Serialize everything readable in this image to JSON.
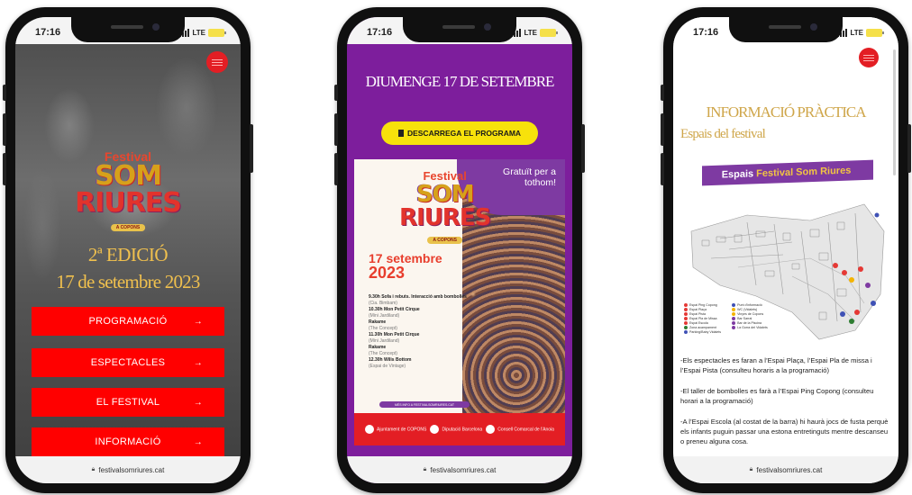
{
  "phones": [
    {
      "status_time": "17:16",
      "carrier": "LTE",
      "url": "festivalsomriures.cat",
      "logo": {
        "line1": "Festival",
        "line2": "SOM",
        "line3": "RIURES",
        "tag": "A COPONS"
      },
      "edition": "2ª EDICIÓ",
      "date": "17 de setembre 2023",
      "menu": [
        {
          "label": "PROGRAMACIÓ",
          "arrow": "→"
        },
        {
          "label": "ESPECTACLES",
          "arrow": "→"
        },
        {
          "label": "EL FESTIVAL",
          "arrow": "→"
        },
        {
          "label": "INFORMACIÓ",
          "arrow": "→"
        }
      ]
    },
    {
      "status_time": "17:16",
      "carrier": "LTE",
      "url": "festivalsomriures.cat",
      "heading": "DIUMENGE 17 DE SETEMBRE",
      "download_label": "DESCARREGA EL PROGRAMA",
      "poster": {
        "logo": {
          "line1": "Festival",
          "line2": "SOM",
          "line3": "RIURES",
          "tag": "A COPONS"
        },
        "ribbon": "Gratuït per a tothom!",
        "date_line1": "17 setembre",
        "date_line2": "2023",
        "schedule": [
          {
            "time": "9.30h",
            "title": "Sofa i rebuts. Interacció amb bombolles",
            "sub": "(Cia. Bimbam)"
          },
          {
            "time": "10.30h",
            "title": "Mon Petit Cirque",
            "sub": "(Mini Jardiland)"
          },
          {
            "time": "",
            "title": "Rakame",
            "sub": "(The Concept)"
          },
          {
            "time": "11.30h",
            "title": "Mon Petit Cirque",
            "sub": "(Mini Jardiland)"
          },
          {
            "time": "",
            "title": "Rakame",
            "sub": "(The Concept)"
          },
          {
            "time": "12.30h",
            "title": "Wilis Bottom",
            "sub": "(Espai de Vintage)"
          }
        ],
        "web": "MÉS INFO A FESTIVALSOMRIURES.CAT",
        "footer": [
          "Ajuntament de COPONS",
          "Diputació Barcelona",
          "Consell Comarcal de l'Anoia"
        ]
      }
    },
    {
      "status_time": "17:16",
      "carrier": "LTE",
      "url": "festivalsomriures.cat",
      "heading": "INFORMACIÓ PRÀCTICA",
      "subheading": "Espais del festival",
      "banner": {
        "pre": "Espais",
        "accent": "Festival Som Riures",
        "post": ""
      },
      "legend_left": [
        "Espai Ping Copong",
        "Espai Plaça",
        "Espai Pista",
        "Espai Pla de Missa",
        "Espai Escola",
        "Zona acampament",
        "Parking/Baby Vidalets"
      ],
      "legend_right": [
        "Punt d'informació",
        "WC (Vidalets)",
        "Vinyes de Copons",
        "Bar Sarral",
        "Bar de la Piscina",
        "La Gorra del Vidalets"
      ],
      "paragraphs": [
        "-Els espectacles es faran a l’Espai Plaça, l’Espai Pla de missa i l’Espai Pista (consulteu horaris a la programació)",
        "-El taller de bombolles es farà a l’Espai Ping Copong (consulteu horari a la programació)",
        "-A l’Espai Escola (al costat de la barra) hi haurà jocs de fusta perquè els infants puguin passar una estona entretinguts mentre descanseu o preneu alguna cosa."
      ]
    }
  ],
  "colors": {
    "red": "#ff0000",
    "purple": "#7d1e9c",
    "gold": "#f0c04e",
    "yellow": "#f7e20b"
  }
}
